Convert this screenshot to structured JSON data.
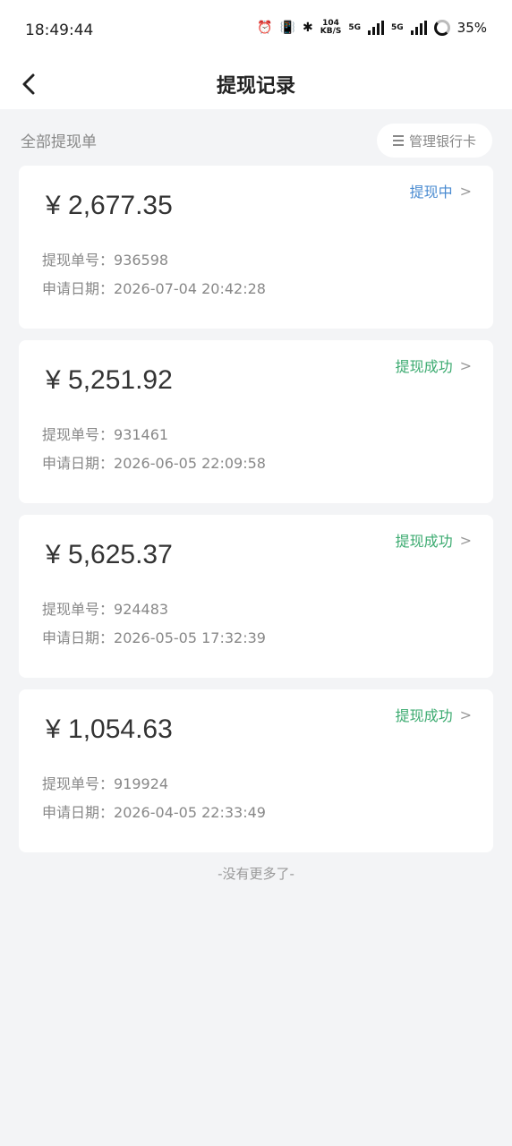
{
  "status_bar": {
    "time": "18:49:44",
    "net_speed_top": "104",
    "net_speed_unit": "KB/S",
    "network_1": "5G",
    "network_2": "5G",
    "battery": "35%"
  },
  "header": {
    "title": "提现记录"
  },
  "filter": {
    "label": "全部提现单",
    "manage_button": "管理银行卡"
  },
  "records": [
    {
      "amount": "¥ 2,677.35",
      "status": "提现中",
      "status_type": "processing",
      "order_label": "提现单号：",
      "order_no": "936598",
      "date_label": "申请日期：",
      "date": "2026-07-04 20:42:28"
    },
    {
      "amount": "¥ 5,251.92",
      "status": "提现成功",
      "status_type": "success",
      "order_label": "提现单号：",
      "order_no": "931461",
      "date_label": "申请日期：",
      "date": "2026-06-05 22:09:58"
    },
    {
      "amount": "¥ 5,625.37",
      "status": "提现成功",
      "status_type": "success",
      "order_label": "提现单号：",
      "order_no": "924483",
      "date_label": "申请日期：",
      "date": "2026-05-05 17:32:39"
    },
    {
      "amount": "¥ 1,054.63",
      "status": "提现成功",
      "status_type": "success",
      "order_label": "提现单号：",
      "order_no": "919924",
      "date_label": "申请日期：",
      "date": "2026-04-05 22:33:49"
    }
  ],
  "footer": {
    "no_more": "-没有更多了-"
  },
  "colors": {
    "processing": "#4a8bd1",
    "success": "#3aaa6f",
    "background": "#f3f4f6"
  }
}
